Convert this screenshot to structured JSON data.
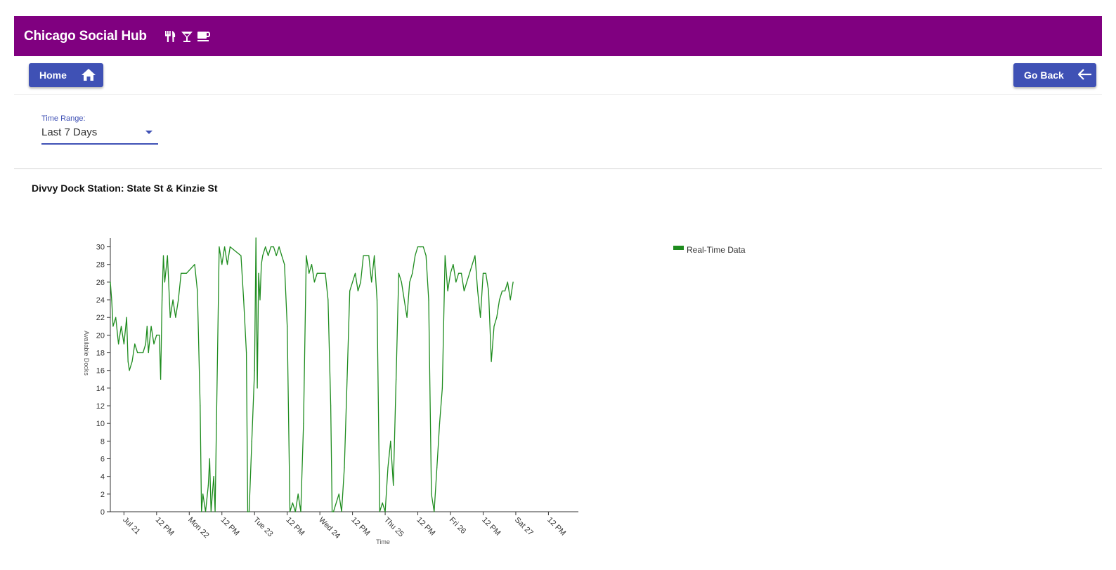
{
  "header": {
    "title": "Chicago Social Hub",
    "icons": [
      "restaurant-icon",
      "bar-cocktail-icon",
      "coffee-icon"
    ],
    "background": "#800080"
  },
  "nav": {
    "home_label": "Home",
    "back_label": "Go Back",
    "button_color": "#3f51b5"
  },
  "filter": {
    "label": "Time Range:",
    "value": "Last 7 Days"
  },
  "chart_title": "Divvy Dock Station: State St & Kinzie St",
  "chart_data": {
    "type": "line",
    "title": "",
    "xlabel": "Time",
    "ylabel": "Available Docks",
    "ylim": [
      0,
      31
    ],
    "xlim": [
      "2019-07-20T19:00",
      "2019-07-27T23:00"
    ],
    "grid": false,
    "legend_position": "top-right",
    "y_ticks": [
      0,
      2,
      4,
      6,
      8,
      10,
      12,
      14,
      16,
      18,
      20,
      22,
      24,
      26,
      28,
      30
    ],
    "x_ticks": [
      {
        "t": "2019-07-21T00:00",
        "label": "Jul 21"
      },
      {
        "t": "2019-07-21T12:00",
        "label": "12 PM"
      },
      {
        "t": "2019-07-22T00:00",
        "label": "Mon 22"
      },
      {
        "t": "2019-07-22T12:00",
        "label": "12 PM"
      },
      {
        "t": "2019-07-23T00:00",
        "label": "Tue 23"
      },
      {
        "t": "2019-07-23T12:00",
        "label": "12 PM"
      },
      {
        "t": "2019-07-24T00:00",
        "label": "Wed 24"
      },
      {
        "t": "2019-07-24T12:00",
        "label": "12 PM"
      },
      {
        "t": "2019-07-25T00:00",
        "label": "Thu 25"
      },
      {
        "t": "2019-07-25T12:00",
        "label": "12 PM"
      },
      {
        "t": "2019-07-26T00:00",
        "label": "Fri 26"
      },
      {
        "t": "2019-07-26T12:00",
        "label": "12 PM"
      },
      {
        "t": "2019-07-27T00:00",
        "label": "Sat 27"
      },
      {
        "t": "2019-07-27T12:00",
        "label": "12 PM"
      }
    ],
    "series": [
      {
        "name": "Real-Time Data",
        "color": "#1e8c1e",
        "points": [
          [
            "2019-07-20T19:00",
            26
          ],
          [
            "2019-07-20T19:30",
            24
          ],
          [
            "2019-07-20T20:00",
            21
          ],
          [
            "2019-07-20T21:00",
            22
          ],
          [
            "2019-07-20T22:00",
            19
          ],
          [
            "2019-07-20T23:00",
            21
          ],
          [
            "2019-07-21T00:00",
            19
          ],
          [
            "2019-07-21T01:00",
            22
          ],
          [
            "2019-07-21T01:30",
            17
          ],
          [
            "2019-07-21T02:00",
            16
          ],
          [
            "2019-07-21T03:00",
            17
          ],
          [
            "2019-07-21T04:00",
            19
          ],
          [
            "2019-07-21T05:00",
            18
          ],
          [
            "2019-07-21T07:00",
            18
          ],
          [
            "2019-07-21T08:00",
            19
          ],
          [
            "2019-07-21T08:30",
            21
          ],
          [
            "2019-07-21T09:00",
            18
          ],
          [
            "2019-07-21T10:00",
            21
          ],
          [
            "2019-07-21T11:00",
            19
          ],
          [
            "2019-07-21T12:00",
            20
          ],
          [
            "2019-07-21T13:00",
            20
          ],
          [
            "2019-07-21T13:30",
            15
          ],
          [
            "2019-07-21T14:00",
            24
          ],
          [
            "2019-07-21T14:30",
            29
          ],
          [
            "2019-07-21T15:00",
            26
          ],
          [
            "2019-07-21T16:00",
            29
          ],
          [
            "2019-07-21T17:00",
            22
          ],
          [
            "2019-07-21T18:00",
            24
          ],
          [
            "2019-07-21T19:00",
            22
          ],
          [
            "2019-07-21T20:00",
            24
          ],
          [
            "2019-07-21T21:00",
            27
          ],
          [
            "2019-07-21T23:00",
            27
          ],
          [
            "2019-07-22T02:00",
            28
          ],
          [
            "2019-07-22T03:00",
            25
          ],
          [
            "2019-07-22T04:00",
            12
          ],
          [
            "2019-07-22T04:30",
            0
          ],
          [
            "2019-07-22T05:00",
            2
          ],
          [
            "2019-07-22T06:00",
            0
          ],
          [
            "2019-07-22T07:00",
            3
          ],
          [
            "2019-07-22T07:30",
            6
          ],
          [
            "2019-07-22T08:00",
            0
          ],
          [
            "2019-07-22T09:00",
            4
          ],
          [
            "2019-07-22T09:30",
            0
          ],
          [
            "2019-07-22T10:00",
            10
          ],
          [
            "2019-07-22T11:00",
            30
          ],
          [
            "2019-07-22T12:00",
            28
          ],
          [
            "2019-07-22T13:00",
            30
          ],
          [
            "2019-07-22T14:00",
            28
          ],
          [
            "2019-07-22T15:00",
            30
          ],
          [
            "2019-07-22T19:00",
            29
          ],
          [
            "2019-07-22T20:00",
            24
          ],
          [
            "2019-07-22T21:00",
            18
          ],
          [
            "2019-07-22T21:30",
            0
          ],
          [
            "2019-07-22T22:00",
            0
          ],
          [
            "2019-07-22T23:00",
            8
          ],
          [
            "2019-07-23T00:00",
            16
          ],
          [
            "2019-07-23T00:30",
            31
          ],
          [
            "2019-07-23T01:00",
            14
          ],
          [
            "2019-07-23T01:30",
            27
          ],
          [
            "2019-07-23T02:00",
            24
          ],
          [
            "2019-07-23T02:30",
            28
          ],
          [
            "2019-07-23T03:00",
            29
          ],
          [
            "2019-07-23T04:00",
            30
          ],
          [
            "2019-07-23T05:00",
            29
          ],
          [
            "2019-07-23T06:00",
            30
          ],
          [
            "2019-07-23T07:00",
            30
          ],
          [
            "2019-07-23T08:00",
            29
          ],
          [
            "2019-07-23T09:00",
            30
          ],
          [
            "2019-07-23T10:00",
            29
          ],
          [
            "2019-07-23T11:00",
            28
          ],
          [
            "2019-07-23T12:00",
            21
          ],
          [
            "2019-07-23T13:00",
            0
          ],
          [
            "2019-07-23T14:00",
            1
          ],
          [
            "2019-07-23T15:00",
            0
          ],
          [
            "2019-07-23T16:00",
            2
          ],
          [
            "2019-07-23T17:00",
            0
          ],
          [
            "2019-07-23T18:00",
            10
          ],
          [
            "2019-07-23T19:00",
            29
          ],
          [
            "2019-07-23T20:00",
            27
          ],
          [
            "2019-07-23T21:00",
            28
          ],
          [
            "2019-07-23T22:00",
            26
          ],
          [
            "2019-07-23T23:00",
            27
          ],
          [
            "2019-07-24T02:00",
            27
          ],
          [
            "2019-07-24T03:00",
            24
          ],
          [
            "2019-07-24T04:00",
            12
          ],
          [
            "2019-07-24T04:30",
            0
          ],
          [
            "2019-07-24T05:00",
            0
          ],
          [
            "2019-07-24T07:00",
            2
          ],
          [
            "2019-07-24T08:00",
            0
          ],
          [
            "2019-07-24T09:00",
            5
          ],
          [
            "2019-07-24T10:00",
            15
          ],
          [
            "2019-07-24T11:00",
            25
          ],
          [
            "2019-07-24T12:00",
            26
          ],
          [
            "2019-07-24T13:00",
            27
          ],
          [
            "2019-07-24T14:00",
            25
          ],
          [
            "2019-07-24T15:00",
            26
          ],
          [
            "2019-07-24T16:00",
            29
          ],
          [
            "2019-07-24T17:00",
            29
          ],
          [
            "2019-07-24T18:00",
            29
          ],
          [
            "2019-07-24T19:00",
            26
          ],
          [
            "2019-07-24T20:00",
            29
          ],
          [
            "2019-07-24T21:00",
            24
          ],
          [
            "2019-07-24T22:00",
            0
          ],
          [
            "2019-07-24T23:00",
            1
          ],
          [
            "2019-07-25T00:00",
            0
          ],
          [
            "2019-07-25T01:00",
            5
          ],
          [
            "2019-07-25T02:00",
            8
          ],
          [
            "2019-07-25T03:00",
            3
          ],
          [
            "2019-07-25T04:00",
            15
          ],
          [
            "2019-07-25T05:00",
            27
          ],
          [
            "2019-07-25T06:00",
            26
          ],
          [
            "2019-07-25T07:00",
            24
          ],
          [
            "2019-07-25T08:00",
            22
          ],
          [
            "2019-07-25T09:00",
            26
          ],
          [
            "2019-07-25T10:00",
            27
          ],
          [
            "2019-07-25T11:00",
            29
          ],
          [
            "2019-07-25T12:00",
            30
          ],
          [
            "2019-07-25T13:00",
            30
          ],
          [
            "2019-07-25T14:00",
            30
          ],
          [
            "2019-07-25T15:00",
            29
          ],
          [
            "2019-07-25T16:00",
            24
          ],
          [
            "2019-07-25T17:00",
            2
          ],
          [
            "2019-07-25T18:00",
            0
          ],
          [
            "2019-07-25T19:00",
            5
          ],
          [
            "2019-07-25T20:00",
            10
          ],
          [
            "2019-07-25T21:00",
            14
          ],
          [
            "2019-07-25T22:00",
            29
          ],
          [
            "2019-07-25T23:00",
            25
          ],
          [
            "2019-07-26T00:00",
            27
          ],
          [
            "2019-07-26T01:00",
            28
          ],
          [
            "2019-07-26T02:00",
            26
          ],
          [
            "2019-07-26T03:00",
            27
          ],
          [
            "2019-07-26T04:00",
            27
          ],
          [
            "2019-07-26T05:00",
            25
          ],
          [
            "2019-07-26T06:00",
            26
          ],
          [
            "2019-07-26T07:00",
            27
          ],
          [
            "2019-07-26T08:00",
            28
          ],
          [
            "2019-07-26T09:00",
            29
          ],
          [
            "2019-07-26T10:00",
            25
          ],
          [
            "2019-07-26T11:00",
            22
          ],
          [
            "2019-07-26T12:00",
            27
          ],
          [
            "2019-07-26T13:00",
            27
          ],
          [
            "2019-07-26T14:00",
            25
          ],
          [
            "2019-07-26T15:00",
            17
          ],
          [
            "2019-07-26T16:00",
            21
          ],
          [
            "2019-07-26T17:00",
            22
          ],
          [
            "2019-07-26T18:00",
            24
          ],
          [
            "2019-07-26T19:00",
            25
          ],
          [
            "2019-07-26T20:00",
            25
          ],
          [
            "2019-07-26T21:00",
            26
          ],
          [
            "2019-07-26T22:00",
            24
          ],
          [
            "2019-07-26T23:00",
            26
          ]
        ]
      }
    ]
  }
}
